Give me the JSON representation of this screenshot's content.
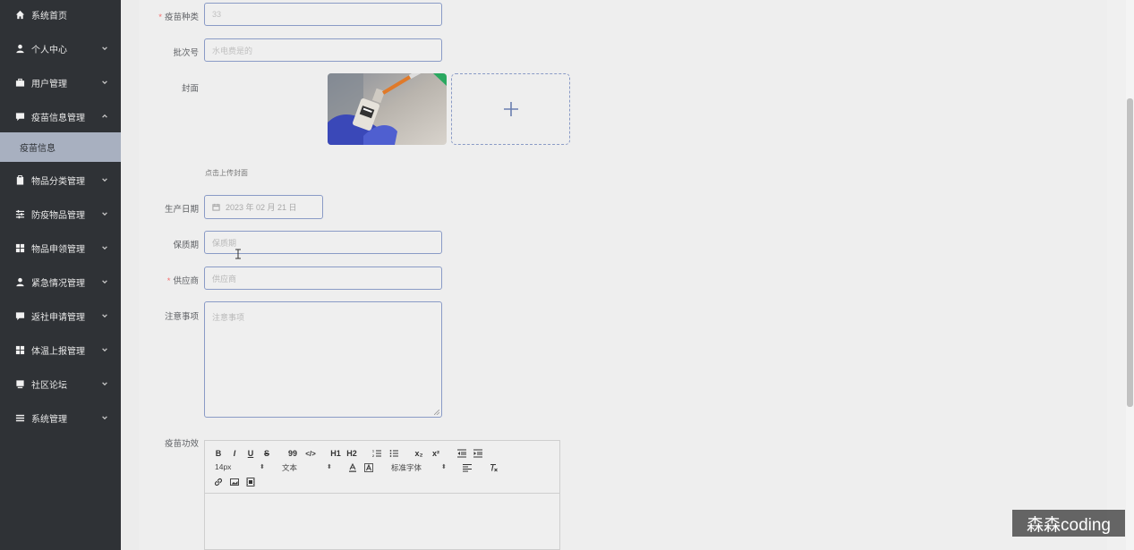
{
  "sidebar": {
    "items": [
      {
        "label": "系统首页",
        "icon": "home-icon",
        "has_arrow": false
      },
      {
        "label": "个人中心",
        "icon": "user-icon",
        "has_arrow": true
      },
      {
        "label": "用户管理",
        "icon": "briefcase-icon",
        "has_arrow": true
      },
      {
        "label": "疫苗信息管理",
        "icon": "chat-icon",
        "has_arrow": true,
        "expanded": true
      },
      {
        "label": "物品分类管理",
        "icon": "clipboard-icon",
        "has_arrow": true
      },
      {
        "label": "防疫物品管理",
        "icon": "sliders-icon",
        "has_arrow": true
      },
      {
        "label": "物品申领管理",
        "icon": "grid-icon",
        "has_arrow": true
      },
      {
        "label": "紧急情况管理",
        "icon": "user-icon",
        "has_arrow": true
      },
      {
        "label": "返社申请管理",
        "icon": "chat-icon",
        "has_arrow": true
      },
      {
        "label": "体温上报管理",
        "icon": "grid-icon",
        "has_arrow": true
      },
      {
        "label": "社区论坛",
        "icon": "monitor-icon",
        "has_arrow": true
      },
      {
        "label": "系统管理",
        "icon": "menu-icon",
        "has_arrow": true
      }
    ],
    "active_sub": "疫苗信息"
  },
  "form": {
    "vaccine_type": {
      "label": "疫苗种类",
      "value": "33",
      "required": true
    },
    "batch_no": {
      "label": "批次号",
      "value": "水电费是的"
    },
    "cover": {
      "label": "封面",
      "tip": "点击上传封面"
    },
    "production_date": {
      "label": "生产日期",
      "value": "2023 年 02 月 21 日"
    },
    "shelf_life": {
      "label": "保质期",
      "placeholder": "保质期"
    },
    "supplier": {
      "label": "供应商",
      "placeholder": "供应商",
      "required": true
    },
    "notes": {
      "label": "注意事项",
      "placeholder": "注意事项"
    },
    "efficacy": {
      "label": "疫苗功效"
    }
  },
  "editor": {
    "font_size": "14px",
    "text_style": "文本",
    "font_family": "标准字体",
    "buttons": [
      "B",
      "I",
      "U",
      "S",
      "99",
      "</>",
      "H1",
      "H2",
      "x₂",
      "x²"
    ]
  },
  "watermark": "森森coding"
}
